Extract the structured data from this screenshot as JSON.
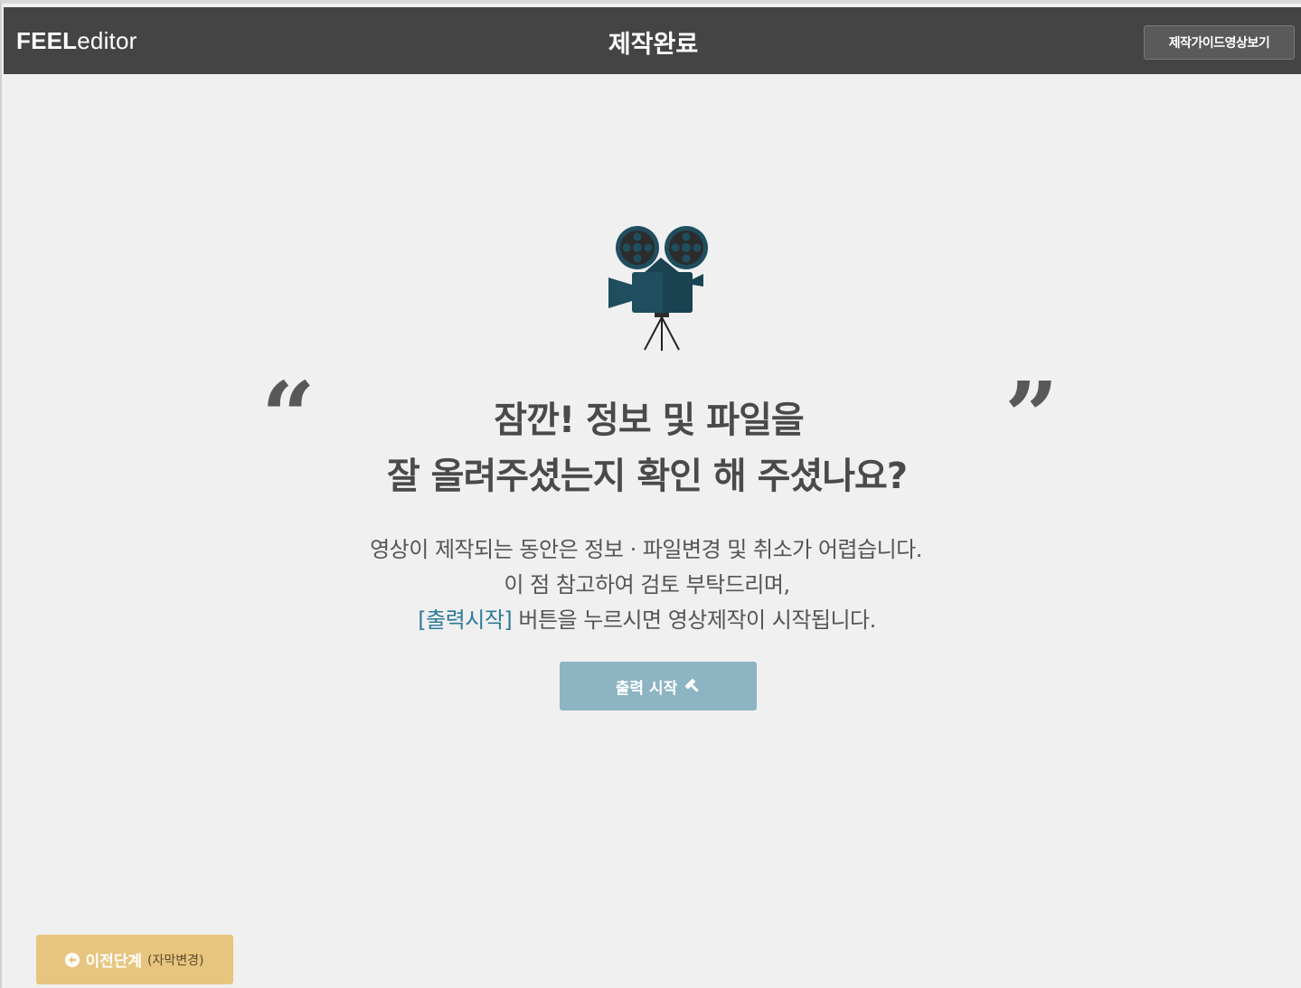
{
  "header": {
    "logo_bold": "FEEL",
    "logo_thin": "editor",
    "title": "제작완료",
    "guide_button": "제작가이드영상보기"
  },
  "main": {
    "quote_open": "“",
    "quote_close": "”",
    "headline_line1": "잠깐! 정보 및 파일을",
    "headline_line2": "잘 올려주셨는지 확인 해 주셨나요?",
    "desc_line1": "영상이 제작되는 동안은 정보 · 파일변경 및 취소가 어렵습니다.",
    "desc_line2": "이 점 참고하여 검토 부탁드리며,",
    "desc_line3_accent": "[출력시작]",
    "desc_line3_rest": " 버튼을 누르시면 영상제작이 시작됩니다.",
    "start_button": "출력 시작"
  },
  "footer": {
    "prev_button": "이전단계",
    "prev_button_sub": "(자막변경)"
  },
  "colors": {
    "topbar": "#444444",
    "accent": "#2e7a99",
    "start_button": "#8db4c2",
    "prev_button": "#e8c57f",
    "projector": "#1f4e5f"
  },
  "icons": {
    "projector": "film-projector-icon",
    "start": "hammer-icon",
    "prev": "circle-arrow-left-icon"
  }
}
